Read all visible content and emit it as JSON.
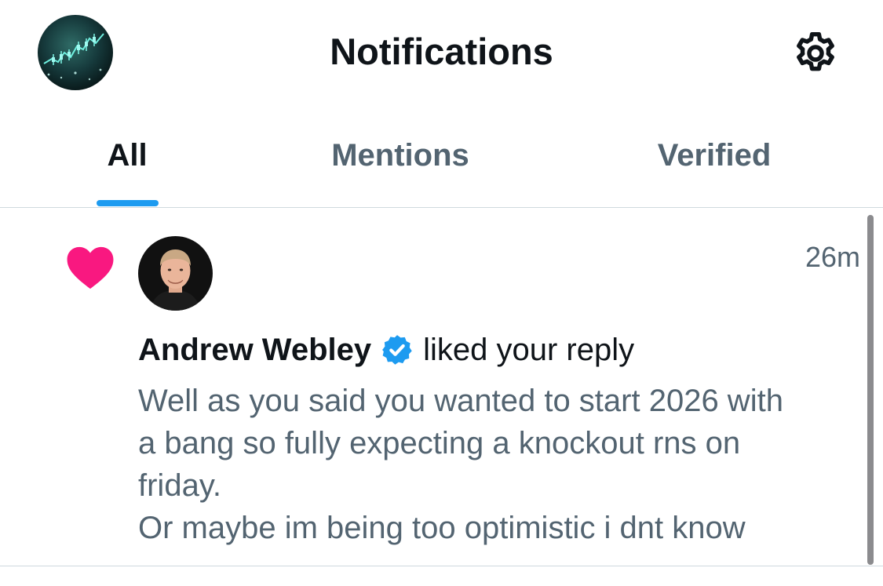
{
  "header": {
    "title": "Notifications",
    "avatar_icon": "chart-avatar-icon",
    "settings_icon": "gear-icon"
  },
  "tabs": [
    {
      "label": "All",
      "active": true
    },
    {
      "label": "Mentions",
      "active": false
    },
    {
      "label": "Verified",
      "active": false
    }
  ],
  "notification": {
    "type_icon": "heart-icon",
    "actor_name": "Andrew Webley",
    "verified_icon": "verified-badge-icon",
    "action": "liked your reply",
    "time": "26m",
    "reply_lines": [
      "Well as you said you wanted to start 2026 with",
      "a bang so fully expecting a knockout rns on",
      "friday.",
      "Or maybe im being too optimistic i dnt know"
    ]
  },
  "colors": {
    "accent": "#1d9bf0",
    "like": "#f91880",
    "text_primary": "#0f1419",
    "text_secondary": "#536471",
    "divider": "#cfd9de"
  }
}
